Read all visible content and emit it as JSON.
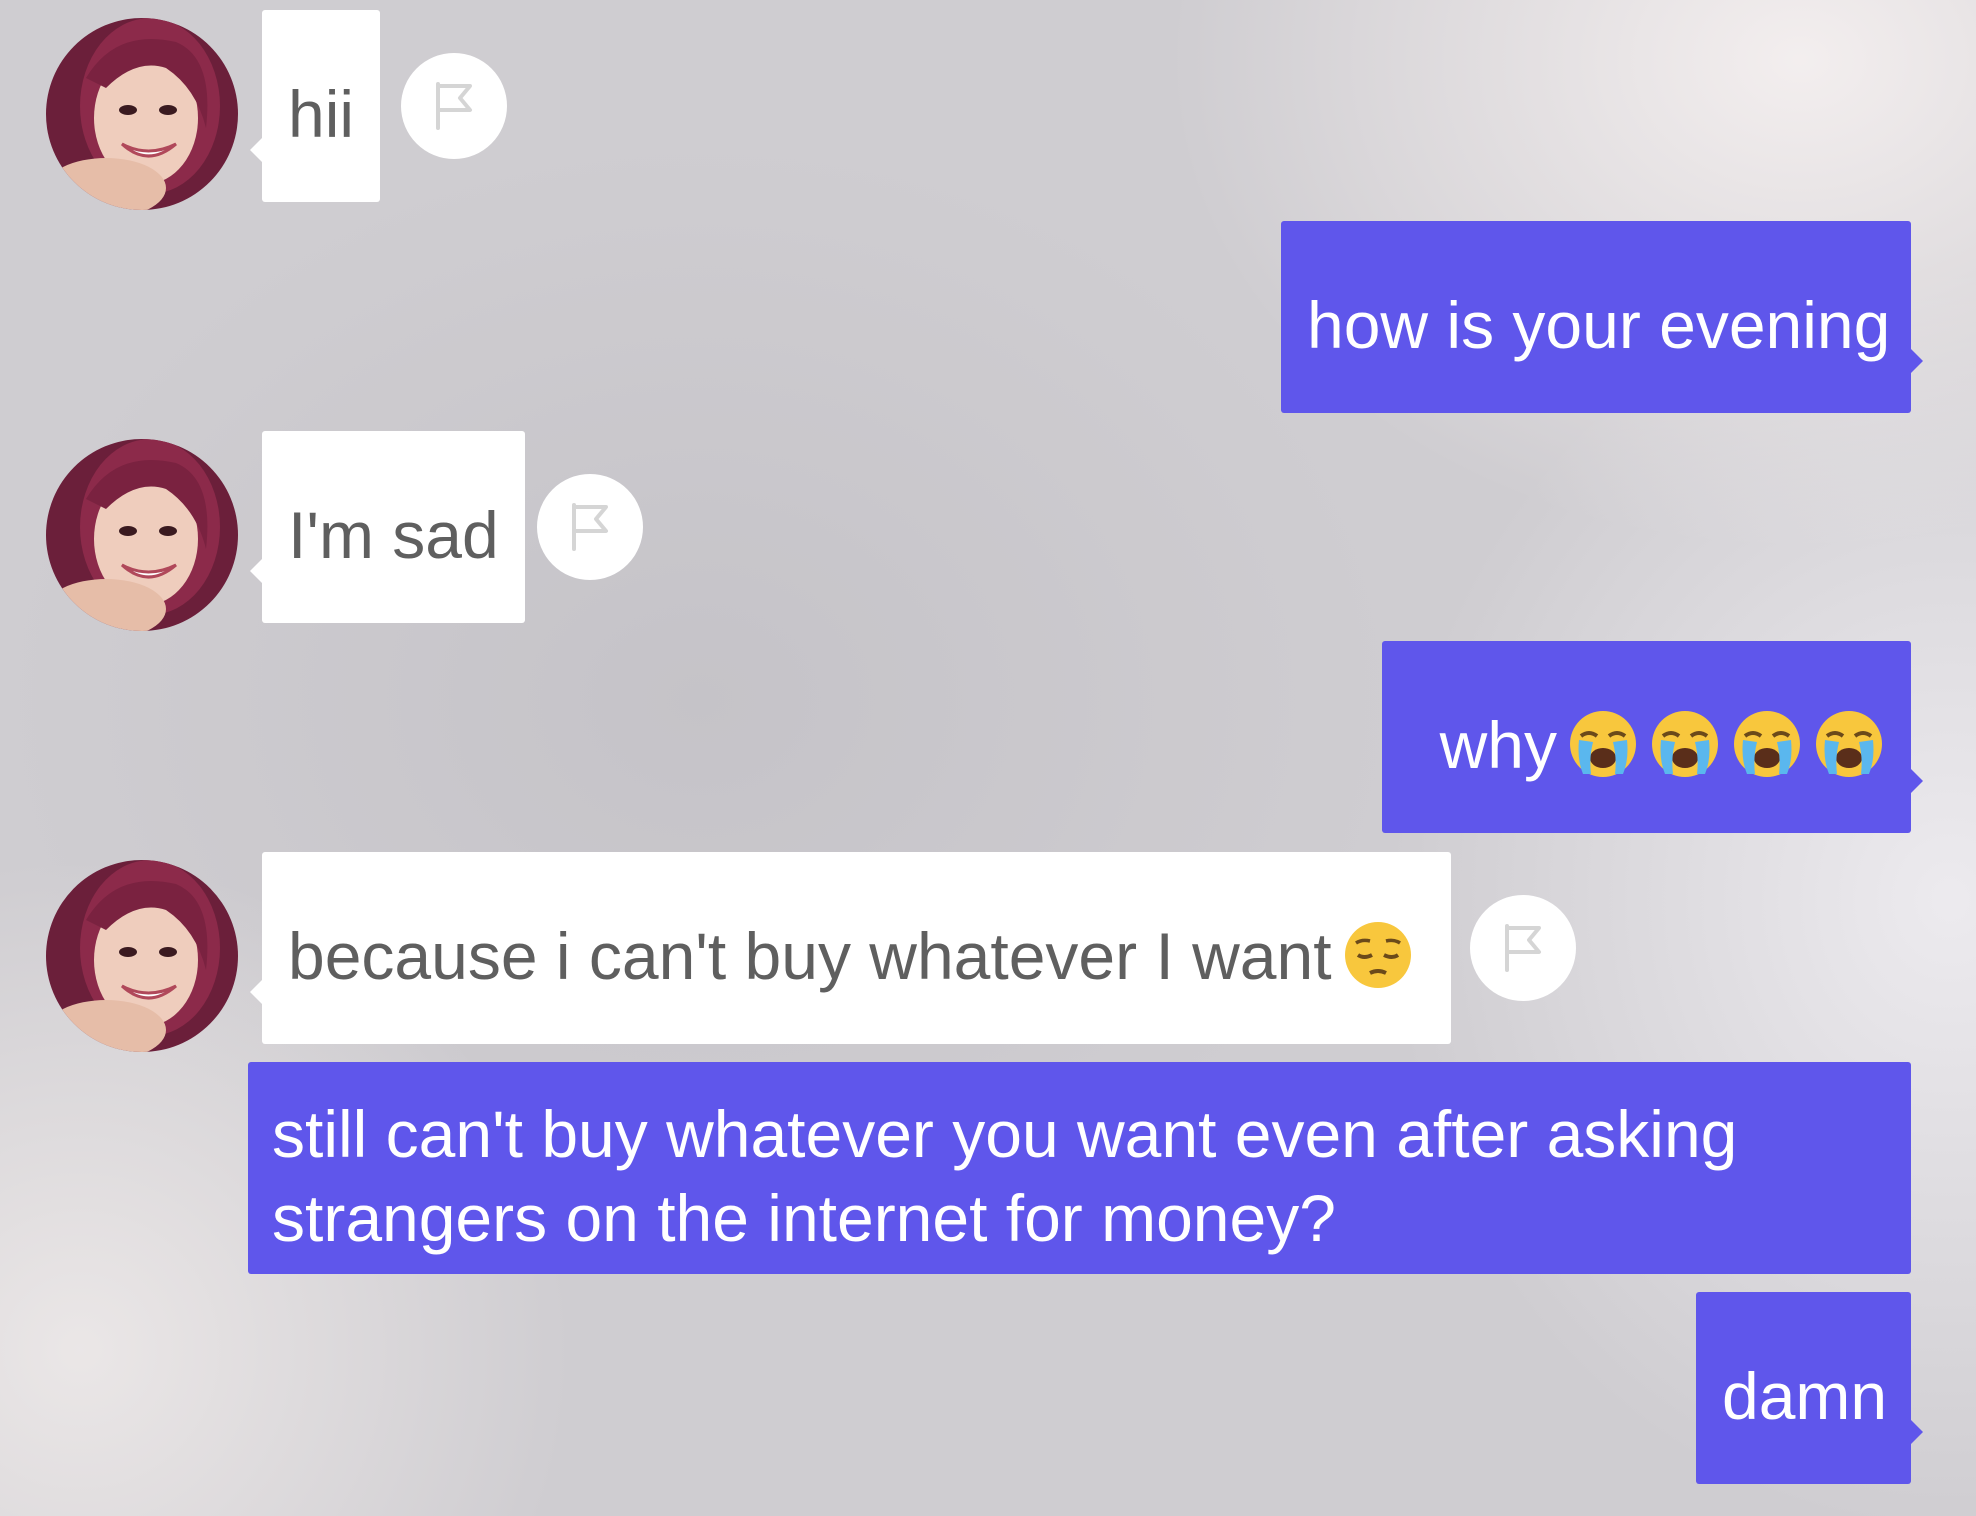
{
  "conversation": {
    "messages": [
      {
        "sender": "them",
        "text": "hii",
        "flag_icon": "flag-icon"
      },
      {
        "sender": "me",
        "text": "how is your evening"
      },
      {
        "sender": "them",
        "text": "I'm sad",
        "flag_icon": "flag-icon"
      },
      {
        "sender": "me",
        "text": "why",
        "emoji": [
          "loudly-crying-face",
          "loudly-crying-face",
          "loudly-crying-face",
          "loudly-crying-face"
        ]
      },
      {
        "sender": "them",
        "text": "because i can't buy whatever I want",
        "emoji": [
          "pensive-face"
        ],
        "flag_icon": "flag-icon"
      },
      {
        "sender": "me",
        "text": "still can't buy whatever you want even after asking strangers on the internet for money?"
      },
      {
        "sender": "me",
        "text": "damn"
      }
    ]
  },
  "colors": {
    "outgoing_bubble": "#5f56eb",
    "incoming_bubble": "#ffffff",
    "incoming_text": "#5f5f5f",
    "outgoing_text": "#ffffff"
  }
}
